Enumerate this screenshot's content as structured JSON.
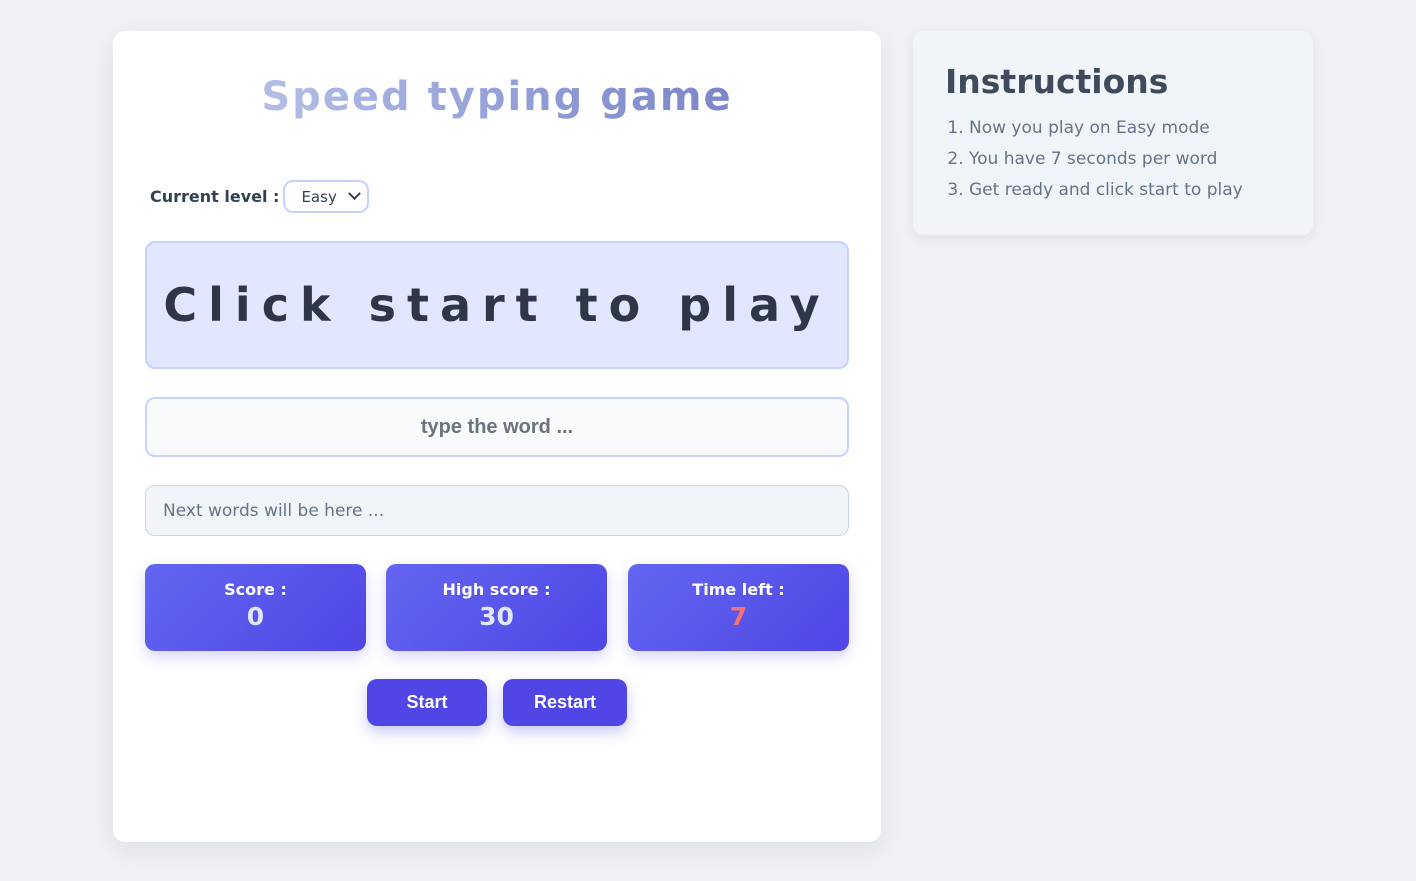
{
  "game": {
    "title": "Speed typing game",
    "level_label": "Current level :",
    "level_selected": "Easy",
    "word_display": "Click start to play",
    "input_placeholder": "type the word ...",
    "upcoming_placeholder": "Next words will be here ...",
    "stats": {
      "score_label": "Score :",
      "score_value": "0",
      "high_score_label": "High score :",
      "high_score_value": "30",
      "time_label": "Time left :",
      "time_value": "7"
    },
    "buttons": {
      "start_label": "Start",
      "restart_label": "Restart"
    }
  },
  "instructions": {
    "title": "Instructions",
    "items": [
      "Now you play on Easy mode",
      "You have 7 seconds per word",
      "Get ready and click start to play"
    ]
  },
  "colors": {
    "background": "#eff1f5",
    "accent": "#4f46e5",
    "word_box": "#e0e7ff",
    "time_alert": "#f87171"
  },
  "icons": {
    "level_dropdown": "chevron-down-icon"
  }
}
